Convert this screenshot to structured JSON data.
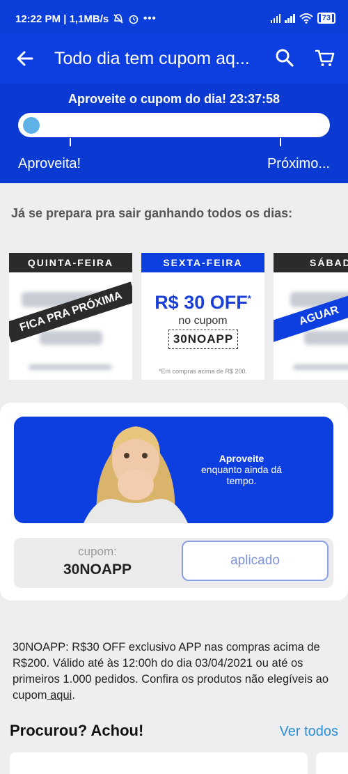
{
  "status_bar": {
    "time": "12:22 PM | 1,1MB/s",
    "battery": "73",
    "icons": [
      "mute-icon",
      "alarm-icon",
      "more-icon",
      "signal-icon",
      "signal-icon",
      "wifi-icon",
      "battery-icon"
    ]
  },
  "header": {
    "title": "Todo dia tem cupom aq...",
    "icons": [
      "back-arrow-icon",
      "search-icon",
      "cart-icon"
    ]
  },
  "promo": {
    "headline": "Aproveite o cupom do dia! 23:37:58",
    "progress": 0,
    "left_label": "Aproveita!",
    "right_label": "Próximo..."
  },
  "intro": "Já se prepara pra sair ganhando todos os dias:",
  "days": [
    {
      "day": "QUINTA-FEIRA",
      "ribbon": "FICA PRA PRÓXIMA"
    },
    {
      "day": "SEXTA-FEIRA",
      "offer": "R$ 30 OFF",
      "offer_mark": "*",
      "prefix": "no cupom",
      "code": "30NOAPP",
      "note": "*Em compras acima de R$ 200."
    },
    {
      "day": "SÁBAD",
      "ribbon": "AGUAR"
    }
  ],
  "banner": {
    "title": "Aproveite",
    "text": "enquanto ainda dá tempo."
  },
  "coupon": {
    "label": "cupom:",
    "code": "30NOAPP",
    "button": "aplicado"
  },
  "terms": {
    "text": "30NOAPP: R$30 OFF exclusivo APP nas compras acima de R$200. Válido até às 12:00h do dia 03/04/2021 ou até os primeiros 1.000 pedidos. Confira os produtos não elegíveis ao cupom",
    "link": " aqui",
    "end": "."
  },
  "section": {
    "title": "Procurou? Achou!",
    "see_all": "Ver todos"
  },
  "colors": {
    "brand_blue": "#0d3fe0",
    "card_dark": "#2b2b2b",
    "link_blue": "#2a8fd6"
  }
}
